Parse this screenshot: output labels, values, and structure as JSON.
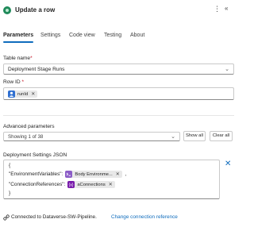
{
  "header": {
    "title": "Update a row",
    "more_icon": "⋮",
    "collapse_icon": "«"
  },
  "tabs": [
    {
      "label": "Parameters",
      "active": true
    },
    {
      "label": "Settings"
    },
    {
      "label": "Code view"
    },
    {
      "label": "Testing"
    },
    {
      "label": "About"
    }
  ],
  "table_name": {
    "label": "Table name",
    "required_mark": "*",
    "value": "Deployment Stage Runs"
  },
  "row_id": {
    "label": "Row ID",
    "required_mark": "*",
    "token": {
      "label": "runId",
      "close": "✕",
      "icon": "dataverse-icon"
    }
  },
  "advanced": {
    "label": "Advanced parameters",
    "selected": "Showing 1 of 38",
    "show_all": "Show all",
    "clear_all": "Clear all"
  },
  "json_field": {
    "label": "Deployment Settings JSON",
    "line1": "{",
    "line2_key": "\"EnvironmentVariables\":",
    "line2_token": "Body Environme...",
    "line2_suffix": ",",
    "line3_key": "\"ConnectionReferences\":",
    "line3_token": "aConnections",
    "line4": "}",
    "close_icon": "✕"
  },
  "footer": {
    "text": "Connected to Dataverse-SW-Pipeline.",
    "link": "Change connection reference"
  },
  "colors": {
    "accent": "#0f6cbd",
    "dataverse_token": "#2f6fd1",
    "compose_token": "#8b5cc7",
    "variable_token": "#7719aa"
  }
}
